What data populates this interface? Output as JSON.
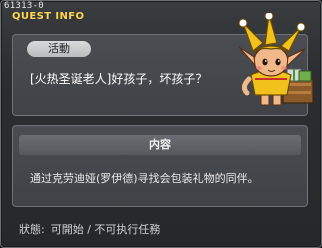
{
  "quest_id": "61313-0",
  "window_title": "QUEST INFO",
  "activity_label": "活動",
  "quest_name": "[火热圣诞老人]好孩子，坏孩子？",
  "content": {
    "header": "内容",
    "text": "通过克劳迪娅(罗伊德)寻找会包装礼物的同伴。"
  },
  "status": {
    "label": "狀態:",
    "value": "可開始 / 不可执行任務"
  },
  "npc": {
    "icon": "jester-elf-npc-icon",
    "hat_color": "#f2c21c",
    "skin_color": "#f1b98a"
  }
}
